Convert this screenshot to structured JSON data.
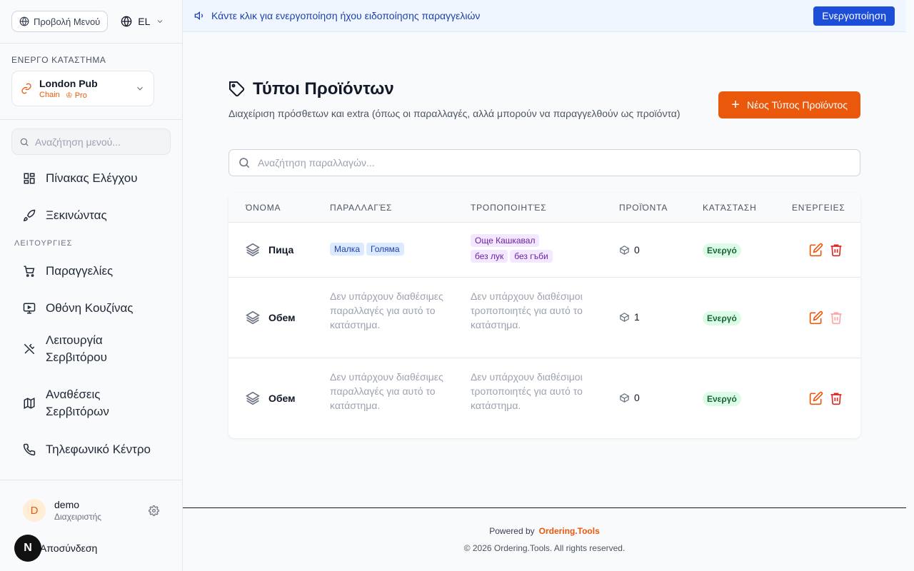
{
  "sidebar": {
    "menu_view_label": "Προβολή Μενού",
    "lang_code": "EL",
    "active_store_label": "ΕΝΕΡΓΟ ΚΑΤΑΣΤΗΜΑ",
    "store": {
      "name": "London Pub",
      "type": "Chain",
      "plan": "Pro"
    },
    "search_placeholder": "Αναζήτηση μενού...",
    "nav_top": [
      {
        "label": "Πίνακας Ελέγχου",
        "icon": "dashboard-icon"
      },
      {
        "label": "Ξεκινώντας",
        "icon": "rocket-icon"
      }
    ],
    "group_label": "ΛΕΙΤΟΥΡΓΙΕΣ",
    "nav_ops": [
      {
        "label": "Παραγγελίες",
        "icon": "cart-icon"
      },
      {
        "label": "Οθόνη Κουζίνας",
        "icon": "monitor-icon"
      },
      {
        "label": "Λειτουργία Σερβιτόρου",
        "icon": "utensils-icon"
      },
      {
        "label": "Αναθέσεις Σερβιτόρων",
        "icon": "map-icon"
      },
      {
        "label": "Τηλεφωνικό Κέντρο",
        "icon": "phone-icon"
      }
    ],
    "user": {
      "initial": "D",
      "name": "demo",
      "role": "Διαχειριστής"
    },
    "logout_label": "Αποσύνδεση",
    "next_badge": "N"
  },
  "banner": {
    "text": "Κάντε κλικ για ενεργοποίηση ήχου ειδοποίησης παραγγελιών",
    "button": "Ενεργοποίηση"
  },
  "page": {
    "title": "Τύποι Προϊόντων",
    "description": "Διαχείριση πρόσθετων και extra (όπως οι παραλλαγές, αλλά μπορούν να παραγγελθούν ως προϊόντα)",
    "new_button": "Νέος Τύπος Προϊόντος",
    "search_placeholder": "Αναζήτηση παραλλαγών..."
  },
  "table": {
    "columns": [
      "ΌΝΟΜΑ",
      "ΠΑΡΑΛΛΑΓΈΣ",
      "ΤΡΟΠΟΠΟΙΗΤΈΣ",
      "ΠΡΟΪΌΝΤΑ",
      "ΚΑΤΆΣΤΑΣΗ",
      "ΕΝΈΡΓΕΙΕΣ"
    ],
    "rows": [
      {
        "name": "Пица",
        "variants": [
          "Малка",
          "Голяма"
        ],
        "modifiers": [
          "Още Кашкавал",
          "без лук",
          "без гъби"
        ],
        "products": "0",
        "status": "Ενεργό",
        "delete_disabled": false
      },
      {
        "name": "Обем",
        "variants_empty": "Δεν υπάρχουν διαθέσιμες παραλλαγές για αυτό το κατάστημα.",
        "modifiers_empty": "Δεν υπάρχουν διαθέσιμοι τροποποιητές για αυτό το κατάστημα.",
        "products": "1",
        "status": "Ενεργό",
        "delete_disabled": true
      },
      {
        "name": "Обем",
        "variants_empty": "Δεν υπάρχουν διαθέσιμες παραλλαγές για αυτό το κατάστημα.",
        "modifiers_empty": "Δεν υπάρχουν διαθέσιμοι τροποποιητές για αυτό το κατάστημα.",
        "products": "0",
        "status": "Ενεργό",
        "delete_disabled": false
      }
    ]
  },
  "footer": {
    "powered_by": "Powered by",
    "brand": "Ordering.Tools",
    "copyright": "© 2026 Ordering.Tools. All rights reserved."
  },
  "colors": {
    "accent": "#ea580c",
    "banner_button": "#1d4ed8",
    "status_bg": "#dcfce7",
    "delete": "#dc2626"
  }
}
